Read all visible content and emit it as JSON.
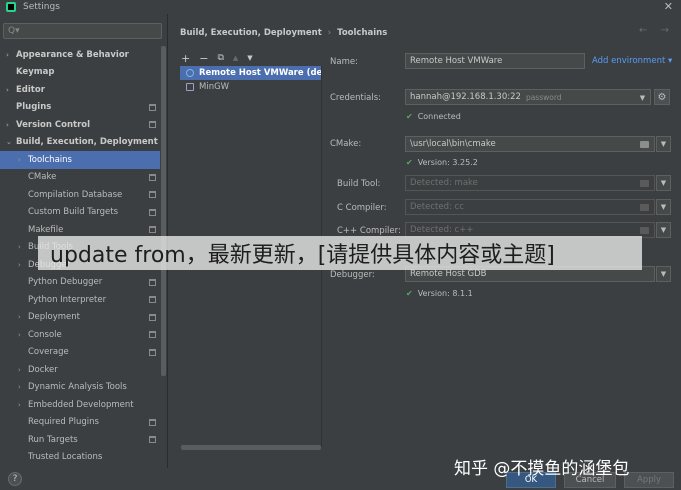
{
  "window": {
    "title": "Settings"
  },
  "search": {
    "placeholder": "Q▾"
  },
  "sidebar": {
    "items": [
      {
        "label": "Appearance & Behavior",
        "arrow": "›",
        "level": 0,
        "bold": true,
        "project": false
      },
      {
        "label": "Keymap",
        "arrow": "",
        "level": 0,
        "bold": true,
        "project": false
      },
      {
        "label": "Editor",
        "arrow": "›",
        "level": 0,
        "bold": true,
        "project": false
      },
      {
        "label": "Plugins",
        "arrow": "",
        "level": 0,
        "bold": true,
        "project": true
      },
      {
        "label": "Version Control",
        "arrow": "›",
        "level": 0,
        "bold": true,
        "project": true
      },
      {
        "label": "Build, Execution, Deployment",
        "arrow": "⌄",
        "level": 0,
        "bold": true,
        "project": false
      },
      {
        "label": "Toolchains",
        "arrow": "›",
        "level": 1,
        "bold": false,
        "project": false,
        "selected": true
      },
      {
        "label": "CMake",
        "arrow": "",
        "level": 1,
        "bold": false,
        "project": true
      },
      {
        "label": "Compilation Database",
        "arrow": "",
        "level": 1,
        "bold": false,
        "project": true
      },
      {
        "label": "Custom Build Targets",
        "arrow": "",
        "level": 1,
        "bold": false,
        "project": true
      },
      {
        "label": "Makefile",
        "arrow": "",
        "level": 1,
        "bold": false,
        "project": true
      },
      {
        "label": "Build Tools",
        "arrow": "›",
        "level": 1,
        "bold": false,
        "project": false
      },
      {
        "label": "Debugger",
        "arrow": "›",
        "level": 1,
        "bold": false,
        "project": false
      },
      {
        "label": "Python Debugger",
        "arrow": "",
        "level": 1,
        "bold": false,
        "project": true
      },
      {
        "label": "Python Interpreter",
        "arrow": "",
        "level": 1,
        "bold": false,
        "project": true
      },
      {
        "label": "Deployment",
        "arrow": "›",
        "level": 1,
        "bold": false,
        "project": true
      },
      {
        "label": "Console",
        "arrow": "›",
        "level": 1,
        "bold": false,
        "project": true
      },
      {
        "label": "Coverage",
        "arrow": "",
        "level": 1,
        "bold": false,
        "project": true
      },
      {
        "label": "Docker",
        "arrow": "›",
        "level": 1,
        "bold": false,
        "project": false
      },
      {
        "label": "Dynamic Analysis Tools",
        "arrow": "›",
        "level": 1,
        "bold": false,
        "project": false
      },
      {
        "label": "Embedded Development",
        "arrow": "›",
        "level": 1,
        "bold": false,
        "project": false
      },
      {
        "label": "Required Plugins",
        "arrow": "",
        "level": 1,
        "bold": false,
        "project": true
      },
      {
        "label": "Run Targets",
        "arrow": "",
        "level": 1,
        "bold": false,
        "project": true
      },
      {
        "label": "Trusted Locations",
        "arrow": "",
        "level": 1,
        "bold": false,
        "project": false
      }
    ]
  },
  "breadcrumb": {
    "parent": "Build, Execution, Deployment",
    "separator": "›",
    "current": "Toolchains"
  },
  "nav": {
    "back": "←",
    "forward": "→"
  },
  "toolbar": {
    "add": "+",
    "remove": "−",
    "copy": "⧉",
    "up": "▲",
    "down": "▼"
  },
  "toolchains": [
    {
      "label": "Remote Host VMWare (default)",
      "selected": true
    },
    {
      "label": "MinGW",
      "selected": false
    }
  ],
  "form": {
    "name_label": "Name:",
    "name_value": "Remote Host VMWare",
    "add_environment": "Add environment ▾",
    "credentials_label": "Credentials:",
    "credentials_value": "hannah@192.168.1.30:22",
    "credentials_auth": "password",
    "credentials_status": "Connected",
    "cmake_label": "CMake:",
    "cmake_value": "\\usr\\local\\bin\\cmake",
    "cmake_version": "Version: 3.25.2",
    "build_tool_label": "Build Tool:",
    "build_tool_value": "Detected: make",
    "c_compiler_label": "C Compiler:",
    "c_compiler_value": "Detected: cc",
    "cpp_compiler_label": "C++ Compiler:",
    "cpp_compiler_value": "Detected: c++",
    "debugger_label": "Debugger:",
    "debugger_value": "Remote Host GDB",
    "debugger_version": "Version: 8.1.1"
  },
  "overlay": {
    "banner_text": "update from，最新更新，[请提供具体内容或主题]",
    "corner_text": "知乎 @不摸鱼的涵堡包"
  },
  "buttons": {
    "help": "?",
    "ok": "OK",
    "cancel": "Cancel",
    "apply": "Apply"
  },
  "colors": {
    "background": "#3c3f41",
    "selection": "#4b6eaf",
    "link": "#589df6",
    "ok_check": "#59a869",
    "primary_button": "#365880"
  }
}
